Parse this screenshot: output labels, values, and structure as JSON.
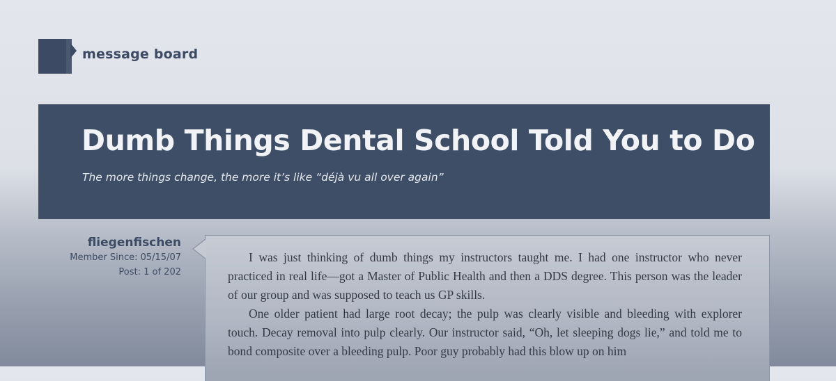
{
  "brand": {
    "name": "message board",
    "icon": "message-board-logo-icon",
    "color": "#3c4b63"
  },
  "banner": {
    "title": "Dumb Things Dental School Told You to Do",
    "subtitle": "The more things change, the more it’s like “déjà vu all over again”",
    "background": "#3e4e66"
  },
  "post": {
    "author": {
      "name": "fliegenfischen",
      "member_since": "Member Since: 05/15/07",
      "post_count": "Post: 1 of 202"
    },
    "paragraphs": [
      "I was just thinking of dumb things my instructors taught me. I had one instructor who never practiced in real life—got a Master of Public Health and then a DDS degree. This person was the leader of our group and was supposed to teach us GP skills.",
      "One older patient had large root decay; the pulp was clearly visible and bleeding with explorer touch. Decay removal into pulp clearly. Our instructor said, “Oh, let sleeping dogs lie,” and told me to bond composite over a bleeding pulp. Poor guy probably had this blow up on him"
    ]
  }
}
